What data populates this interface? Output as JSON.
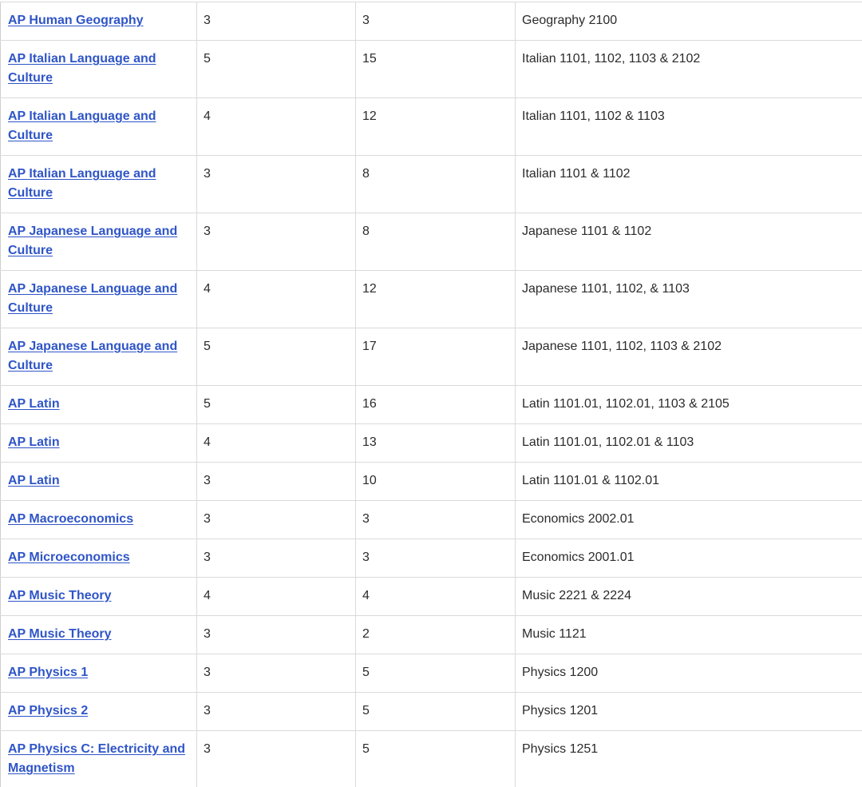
{
  "rows": [
    {
      "course": "AP Human Geography",
      "score": "3",
      "credits": "3",
      "equivalent": "Geography 2100",
      "lines": 1
    },
    {
      "course": "AP Italian Language and Culture",
      "score": "5",
      "credits": "15",
      "equivalent": "Italian 1101, 1102, 1103 & 2102",
      "lines": 2
    },
    {
      "course": "AP Italian Language and Culture",
      "score": "4",
      "credits": "12",
      "equivalent": "Italian 1101, 1102 & 1103",
      "lines": 2
    },
    {
      "course": "AP Italian Language and Culture",
      "score": "3",
      "credits": "8",
      "equivalent": "Italian 1101 & 1102",
      "lines": 2
    },
    {
      "course": "AP Japanese Language and Culture",
      "score": "3",
      "credits": "8",
      "equivalent": "Japanese 1101 & 1102",
      "lines": 2
    },
    {
      "course": "AP Japanese Language and Culture",
      "score": "4",
      "credits": "12",
      "equivalent": "Japanese 1101, 1102, & 1103",
      "lines": 2
    },
    {
      "course": "AP Japanese Language and Culture",
      "score": "5",
      "credits": "17",
      "equivalent": "Japanese 1101, 1102, 1103 & 2102",
      "lines": 2
    },
    {
      "course": "AP Latin",
      "score": "5",
      "credits": "16",
      "equivalent": "Latin 1101.01, 1102.01, 1103 & 2105",
      "lines": 1
    },
    {
      "course": "AP Latin",
      "score": "4",
      "credits": "13",
      "equivalent": "Latin 1101.01, 1102.01 & 1103",
      "lines": 1
    },
    {
      "course": "AP Latin",
      "score": "3",
      "credits": "10",
      "equivalent": "Latin 1101.01 & 1102.01",
      "lines": 1
    },
    {
      "course": "AP Macroeconomics",
      "score": "3",
      "credits": "3",
      "equivalent": "Economics 2002.01",
      "lines": 1
    },
    {
      "course": "AP Microeconomics",
      "score": "3",
      "credits": "3",
      "equivalent": "Economics 2001.01",
      "lines": 1
    },
    {
      "course": "AP Music Theory",
      "score": "4",
      "credits": "4",
      "equivalent": "Music 2221 & 2224",
      "lines": 1
    },
    {
      "course": "AP Music Theory",
      "score": "3",
      "credits": "2",
      "equivalent": "Music 1121",
      "lines": 1
    },
    {
      "course": "AP Physics 1",
      "score": "3",
      "credits": "5",
      "equivalent": "Physics 1200",
      "lines": 1
    },
    {
      "course": "AP Physics 2",
      "score": "3",
      "credits": "5",
      "equivalent": "Physics 1201",
      "lines": 1
    },
    {
      "course": "AP Physics C: Electricity and Magnetism",
      "score": "3",
      "credits": "5",
      "equivalent": "Physics 1251",
      "lines": 2
    }
  ],
  "colors": {
    "link": "#2f55c7",
    "text": "#2b2b2b",
    "border": "#dadada"
  }
}
